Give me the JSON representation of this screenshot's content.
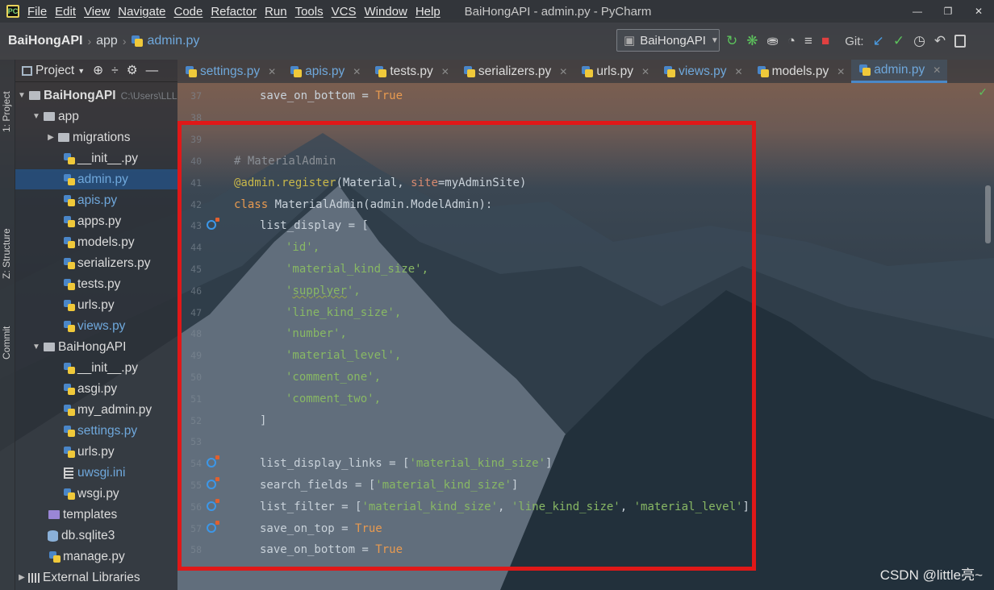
{
  "window": {
    "menu": [
      "File",
      "Edit",
      "View",
      "Navigate",
      "Code",
      "Refactor",
      "Run",
      "Tools",
      "VCS",
      "Window",
      "Help"
    ],
    "title": "BaiHongAPI - admin.py - PyCharm"
  },
  "navbar": {
    "project": "BaiHongAPI",
    "folder": "app",
    "file": "admin.py",
    "run_config": "BaiHongAPI",
    "git_label": "Git:"
  },
  "toolstrip": {
    "project_tab": "1: Project",
    "structure_tab": "Z: Structure",
    "commit_tab": "Commit"
  },
  "project_panel": {
    "title": "Project",
    "root": "BaiHongAPI",
    "root_path": "C:\\Users\\LLL",
    "items": [
      {
        "label": "app",
        "kind": "folder"
      },
      {
        "label": "migrations",
        "kind": "folder"
      },
      {
        "label": "__init__.py",
        "kind": "py"
      },
      {
        "label": "admin.py",
        "kind": "py"
      },
      {
        "label": "apis.py",
        "kind": "py"
      },
      {
        "label": "apps.py",
        "kind": "py"
      },
      {
        "label": "models.py",
        "kind": "py"
      },
      {
        "label": "serializers.py",
        "kind": "py"
      },
      {
        "label": "tests.py",
        "kind": "py"
      },
      {
        "label": "urls.py",
        "kind": "py"
      },
      {
        "label": "views.py",
        "kind": "py"
      },
      {
        "label": "BaiHongAPI",
        "kind": "folder"
      },
      {
        "label": "__init__.py",
        "kind": "py"
      },
      {
        "label": "asgi.py",
        "kind": "py"
      },
      {
        "label": "my_admin.py",
        "kind": "py"
      },
      {
        "label": "settings.py",
        "kind": "py"
      },
      {
        "label": "urls.py",
        "kind": "py"
      },
      {
        "label": "uwsgi.ini",
        "kind": "ini"
      },
      {
        "label": "wsgi.py",
        "kind": "py"
      },
      {
        "label": "templates",
        "kind": "folder"
      },
      {
        "label": "db.sqlite3",
        "kind": "db"
      },
      {
        "label": "manage.py",
        "kind": "py"
      },
      {
        "label": "External Libraries",
        "kind": "lib"
      }
    ]
  },
  "tabs": [
    {
      "label": "settings.py"
    },
    {
      "label": "apis.py"
    },
    {
      "label": "tests.py"
    },
    {
      "label": "serializers.py"
    },
    {
      "label": "urls.py"
    },
    {
      "label": "views.py"
    },
    {
      "label": "models.py"
    },
    {
      "label": "admin.py"
    }
  ],
  "editor": {
    "line_numbers": [
      "37",
      "38",
      "39",
      "40",
      "41",
      "42",
      "43",
      "44",
      "45",
      "46",
      "47",
      "48",
      "49",
      "50",
      "51",
      "52",
      "53",
      "54",
      "55",
      "56",
      "57",
      "58"
    ],
    "lines": {
      "l37": "save_on_bottom = ",
      "true": "True",
      "comment": "# MaterialAdmin",
      "decorator": "@admin.register",
      "decorator_args_a": "(Material, ",
      "site_kw": "site",
      "decorator_args_b": "=myAdminSite)",
      "class_kw": "class",
      "class_rest": " MaterialAdmin(admin.ModelAdmin):",
      "list_display": "list_display = [",
      "s_id": "'id',",
      "s_mks": "'material_kind_size',",
      "s_supplyer_q1": "'",
      "s_supplyer": "supplyer",
      "s_supplyer_q2": "',",
      "s_lks": "'line_kind_size',",
      "s_number": "'number',",
      "s_level": "'material_level',",
      "s_c1": "'comment_one',",
      "s_c2": "'comment_two',",
      "close": "]",
      "links_a": "list_display_links = [",
      "links_b": "'material_kind_size'",
      "links_c": "]",
      "search_a": "search_fields = [",
      "search_b": "'material_kind_size'",
      "search_c": "]",
      "filter_a": "list_filter = [",
      "filter_b": "'material_kind_size'",
      "filter_c": ", ",
      "filter_d": "'line_kind_size'",
      "filter_e": ", ",
      "filter_f": "'material_level'",
      "filter_g": "]",
      "top_a": "save_on_top = ",
      "bottom_a": "save_on_bottom = "
    }
  },
  "watermark": "CSDN @little亮~"
}
